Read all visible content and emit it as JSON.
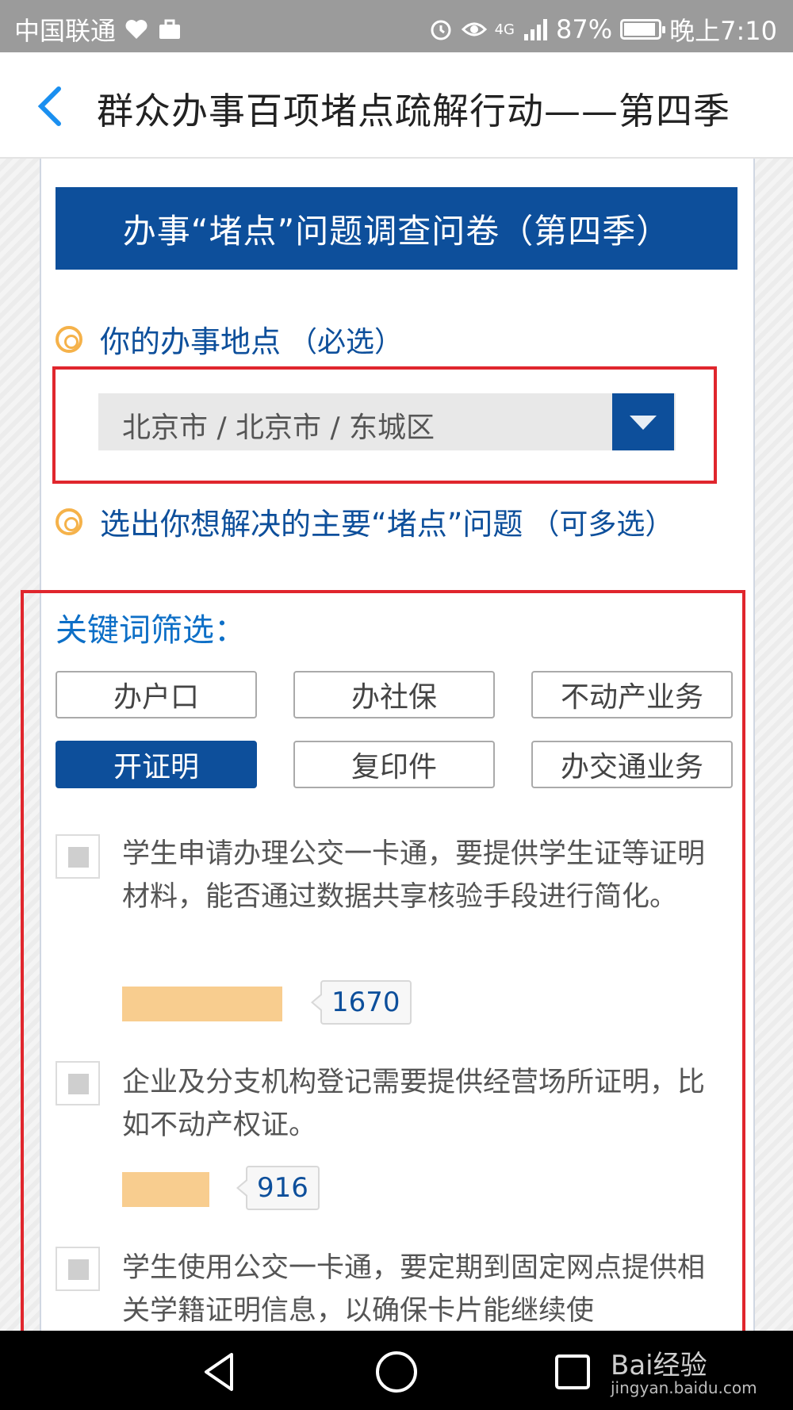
{
  "status_bar": {
    "carrier": "中国联通",
    "network": "4G",
    "battery": "87%",
    "time": "晚上7:10"
  },
  "nav": {
    "title": "群众办事百项堵点疏解行动——第四季"
  },
  "survey": {
    "banner": "办事“堵点”问题调查问卷（第四季）",
    "q1": {
      "label": "你的办事地点",
      "hint": "（必选）"
    },
    "location_value": "北京市 / 北京市 / 东城区",
    "q2": {
      "label": "选出你想解决的主要“堵点”问题",
      "hint": "（可多选）"
    }
  },
  "keywords": {
    "label": "关键词筛选：",
    "chips": [
      {
        "label": "办户口",
        "active": false
      },
      {
        "label": "办社保",
        "active": false
      },
      {
        "label": "不动产业务",
        "active": false
      },
      {
        "label": "开证明",
        "active": true
      },
      {
        "label": "复印件",
        "active": false
      },
      {
        "label": "办交通业务",
        "active": false
      }
    ]
  },
  "options": [
    {
      "text": "学生申请办理公交一卡通，要提供学生证等证明材料，能否通过数据共享核验手段进行简化。",
      "votes": "1670"
    },
    {
      "text": "企业及分支机构登记需要提供经营场所证明，比如不动产权证。",
      "votes": "916"
    },
    {
      "text": "学生使用公交一卡通，要定期到固定网点提供相关学籍证明信息，以确保卡片能继续使"
    }
  ],
  "watermark": {
    "brand": "Bai经验",
    "url": "jingyan.baidu.com"
  }
}
